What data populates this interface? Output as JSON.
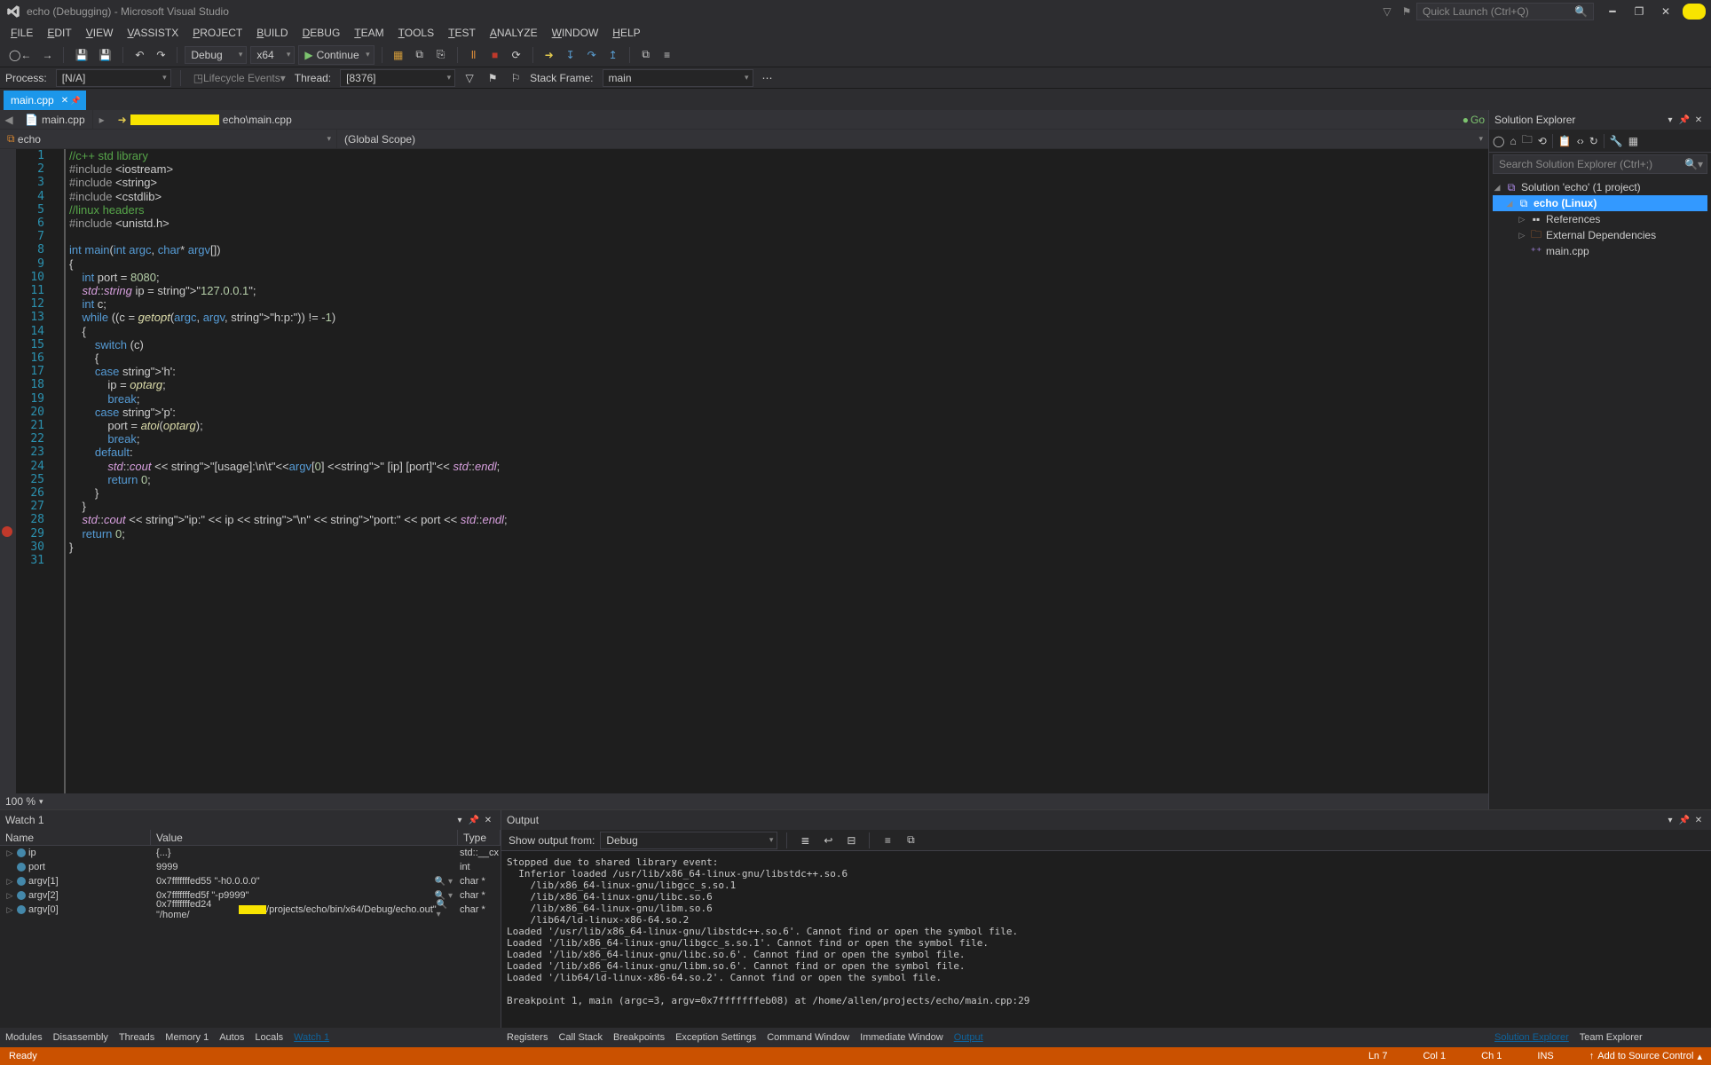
{
  "title": "echo (Debugging) - Microsoft Visual Studio",
  "quick_launch_placeholder": "Quick Launch (Ctrl+Q)",
  "menus": [
    "FILE",
    "EDIT",
    "VIEW",
    "VASSISTX",
    "PROJECT",
    "BUILD",
    "DEBUG",
    "TEAM",
    "TOOLS",
    "TEST",
    "ANALYZE",
    "WINDOW",
    "HELP"
  ],
  "toolbar": {
    "config": "Debug",
    "platform": "x64",
    "continue": "Continue"
  },
  "debugbar": {
    "process_label": "Process:",
    "process": "[N/A]",
    "lifecycle": "Lifecycle Events",
    "thread_label": "Thread:",
    "thread": "[8376]",
    "stack_label": "Stack Frame:",
    "stack": "main"
  },
  "doc_tab": "main.cpp",
  "nav": {
    "crumb": "main.cpp",
    "crumb2": "echo\\main.cpp",
    "go": "Go"
  },
  "scope": {
    "project": "echo",
    "scope": "(Global Scope)"
  },
  "zoom": "100 %",
  "code_lines": [
    "//c++ std library",
    "#include <iostream>",
    "#include <string>",
    "#include <cstdlib>",
    "//linux headers",
    "#include <unistd.h>",
    "",
    "int main(int argc, char* argv[])",
    "{",
    "    int port = 8080;",
    "    std::string ip = \"127.0.0.1\";",
    "    int c;",
    "    while ((c = getopt(argc, argv, \"h:p:\")) != -1)",
    "    {",
    "        switch (c)",
    "        {",
    "        case 'h':",
    "            ip = optarg;",
    "            break;",
    "        case 'p':",
    "            port = atoi(optarg);",
    "            break;",
    "        default:",
    "            std::cout << \"[usage]:\\n\\t\"<<argv[0] <<\" [ip] [port]\"<< std::endl;",
    "            return 0;",
    "        }",
    "    }",
    "    std::cout << \"ip:\" << ip << \"\\n\" << \"port:\" << port << std::endl;",
    "    return 0;",
    "}",
    ""
  ],
  "solution_explorer": {
    "title": "Solution Explorer",
    "search_placeholder": "Search Solution Explorer (Ctrl+;)",
    "root": "Solution 'echo' (1 project)",
    "project": "echo (Linux)",
    "nodes": [
      "References",
      "External Dependencies",
      "main.cpp"
    ]
  },
  "watch": {
    "title": "Watch 1",
    "cols": {
      "name": "Name",
      "value": "Value",
      "type": "Type"
    },
    "rows": [
      {
        "name": "ip",
        "value": "{...}",
        "type": "std::__cx",
        "twist": "▷"
      },
      {
        "name": "port",
        "value": "9999",
        "type": "int",
        "twist": ""
      },
      {
        "name": "argv[1]",
        "value": "0x7fffffffed55 \"-h0.0.0.0\"",
        "type": "char *",
        "twist": "▷",
        "mag": true
      },
      {
        "name": "argv[2]",
        "value": "0x7fffffffed5f \"-p9999\"",
        "type": "char *",
        "twist": "▷",
        "mag": true
      },
      {
        "name": "argv[0]",
        "value": "0x7fffffffed24 \"/home/",
        "value2": "/projects/echo/bin/x64/Debug/echo.out\"",
        "type": "char *",
        "twist": "▷",
        "mag": true,
        "redact": true
      }
    ]
  },
  "output": {
    "title": "Output",
    "from_label": "Show output from:",
    "from": "Debug",
    "text": "Stopped due to shared library event:\n  Inferior loaded /usr/lib/x86_64-linux-gnu/libstdc++.so.6\n    /lib/x86_64-linux-gnu/libgcc_s.so.1\n    /lib/x86_64-linux-gnu/libc.so.6\n    /lib/x86_64-linux-gnu/libm.so.6\n    /lib64/ld-linux-x86-64.so.2\nLoaded '/usr/lib/x86_64-linux-gnu/libstdc++.so.6'. Cannot find or open the symbol file.\nLoaded '/lib/x86_64-linux-gnu/libgcc_s.so.1'. Cannot find or open the symbol file.\nLoaded '/lib/x86_64-linux-gnu/libc.so.6'. Cannot find or open the symbol file.\nLoaded '/lib/x86_64-linux-gnu/libm.so.6'. Cannot find or open the symbol file.\nLoaded '/lib64/ld-linux-x86-64.so.2'. Cannot find or open the symbol file.\n\nBreakpoint 1, main (argc=3, argv=0x7fffffffeb08) at /home/allen/projects/echo/main.cpp:29"
  },
  "bottom_tabs_left": [
    "Modules",
    "Disassembly",
    "Threads",
    "Memory 1",
    "Autos",
    "Locals",
    "Watch 1"
  ],
  "bottom_tabs_right": [
    "Registers",
    "Call Stack",
    "Breakpoints",
    "Exception Settings",
    "Command Window",
    "Immediate Window",
    "Output"
  ],
  "side_tabs": [
    "Solution Explorer",
    "Team Explorer"
  ],
  "status": {
    "ready": "Ready",
    "ln": "Ln 7",
    "col": "Col 1",
    "ch": "Ch 1",
    "ins": "INS",
    "scc": "Add to Source Control"
  }
}
